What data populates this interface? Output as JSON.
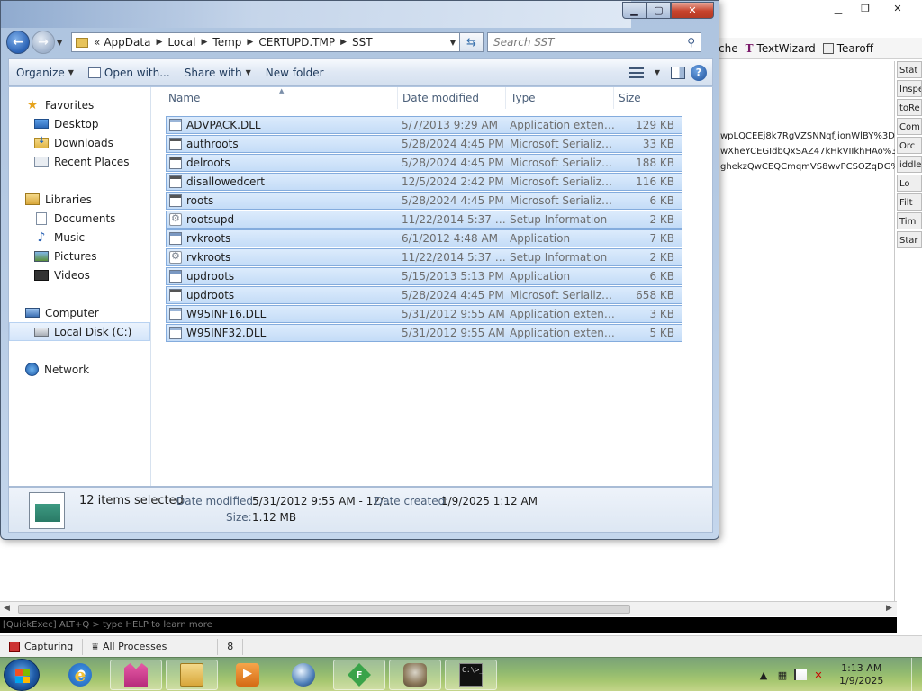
{
  "background_app": {
    "toolbar": [
      {
        "label": "che",
        "icon": "cache-icon"
      },
      {
        "label": "TextWizard",
        "icon": "textwizard-icon"
      },
      {
        "label": "Tearoff",
        "icon": "tearoff-icon"
      }
    ],
    "right_tabs": [
      "Stat",
      "Inspe",
      "toRe",
      "Com",
      "Orc",
      "iddle",
      "Lo",
      "Filt",
      "Tim",
      "Star"
    ],
    "cookie_lines": [
      "wpLQCEEj8k7RgVZSNNqfJionWlBY%3D",
      "wXheYCEGIdbQxSAZ47kHkVIIkhHAo%3D",
      "ghekzQwCEQCmqmVS8wvPCSOZqDG%..."
    ],
    "quickexec": "[QuickExec] ALT+Q > type HELP to learn more",
    "status": {
      "capturing": "Capturing",
      "processes": "All Processes",
      "count": "8"
    }
  },
  "explorer": {
    "address": {
      "overflow": "«",
      "crumbs": [
        "AppData",
        "Local",
        "Temp",
        "CERTUPD.TMP",
        "SST"
      ]
    },
    "search_placeholder": "Search SST",
    "commands": {
      "organize": "Organize",
      "open_with": "Open with...",
      "share_with": "Share with",
      "new_folder": "New folder"
    },
    "nav": {
      "favorites": "Favorites",
      "desktop": "Desktop",
      "downloads": "Downloads",
      "recent": "Recent Places",
      "libraries": "Libraries",
      "documents": "Documents",
      "music": "Music",
      "pictures": "Pictures",
      "videos": "Videos",
      "computer": "Computer",
      "local_disk": "Local Disk (C:)",
      "network": "Network"
    },
    "columns": {
      "name": "Name",
      "date": "Date modified",
      "type": "Type",
      "size": "Size"
    },
    "files": [
      {
        "name": "ADVPACK.DLL",
        "date": "5/7/2013 9:29 AM",
        "type": "Application extens...",
        "size": "129 KB",
        "icon": "app-extension-icon"
      },
      {
        "name": "authroots",
        "date": "5/28/2024 4:45 PM",
        "type": "Microsoft Serialize...",
        "size": "33 KB",
        "icon": "serialized-store-icon"
      },
      {
        "name": "delroots",
        "date": "5/28/2024 4:45 PM",
        "type": "Microsoft Serialize...",
        "size": "188 KB",
        "icon": "serialized-store-icon"
      },
      {
        "name": "disallowedcert",
        "date": "12/5/2024 2:42 PM",
        "type": "Microsoft Serialize...",
        "size": "116 KB",
        "icon": "serialized-store-icon"
      },
      {
        "name": "roots",
        "date": "5/28/2024 4:45 PM",
        "type": "Microsoft Serialize...",
        "size": "6 KB",
        "icon": "serialized-store-icon"
      },
      {
        "name": "rootsupd",
        "date": "11/22/2014 5:37 AM",
        "type": "Setup Information",
        "size": "2 KB",
        "icon": "setup-info-icon"
      },
      {
        "name": "rvkroots",
        "date": "6/1/2012 4:48 AM",
        "type": "Application",
        "size": "7 KB",
        "icon": "application-icon"
      },
      {
        "name": "rvkroots",
        "date": "11/22/2014 5:37 AM",
        "type": "Setup Information",
        "size": "2 KB",
        "icon": "setup-info-icon"
      },
      {
        "name": "updroots",
        "date": "5/15/2013 5:13 PM",
        "type": "Application",
        "size": "6 KB",
        "icon": "application-icon"
      },
      {
        "name": "updroots",
        "date": "5/28/2024 4:45 PM",
        "type": "Microsoft Serialize...",
        "size": "658 KB",
        "icon": "serialized-store-icon"
      },
      {
        "name": "W95INF16.DLL",
        "date": "5/31/2012 9:55 AM",
        "type": "Application extens...",
        "size": "3 KB",
        "icon": "app-extension-icon"
      },
      {
        "name": "W95INF32.DLL",
        "date": "5/31/2012 9:55 AM",
        "type": "Application extens...",
        "size": "5 KB",
        "icon": "app-extension-icon"
      }
    ],
    "details": {
      "selected": "12 items selected",
      "modified_label": "Date modified:",
      "modified_value": "5/31/2012 9:55 AM - 12/...",
      "created_label": "Date created:",
      "created_value": "1/9/2025 1:12 AM",
      "size_label": "Size:",
      "size_value": "1.12 MB"
    }
  },
  "taskbar": {
    "clock_time": "1:13 AM",
    "clock_date": "1/9/2025",
    "fiddler_letter": "F",
    "cmd_text": "C:\\>_"
  }
}
